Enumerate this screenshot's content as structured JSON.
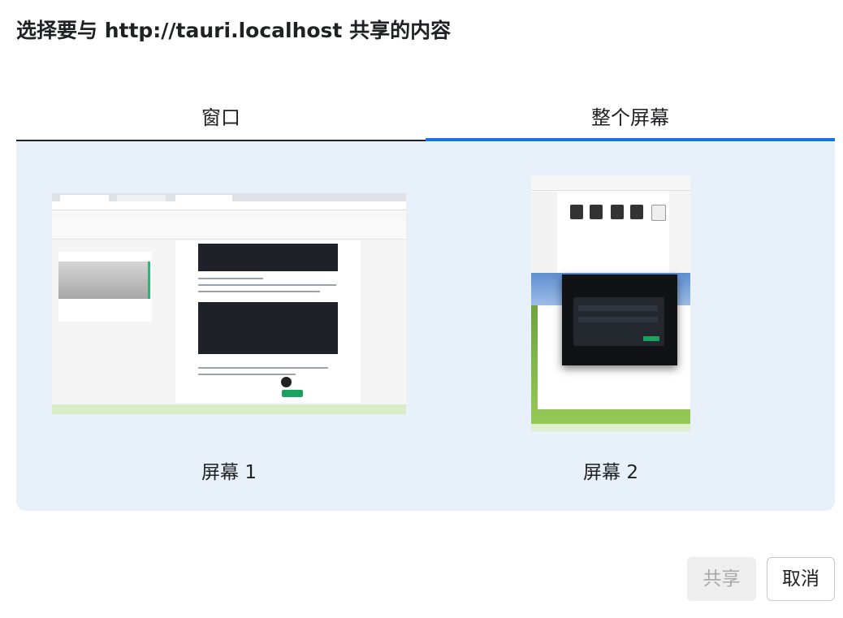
{
  "dialog": {
    "title": "选择要与 http://tauri.localhost 共享的内容"
  },
  "tabs": [
    {
      "label": "窗口",
      "selected": false
    },
    {
      "label": "整个屏幕",
      "selected": true
    }
  ],
  "sources": [
    {
      "label": "屏幕 1"
    },
    {
      "label": "屏幕 2"
    }
  ],
  "buttons": {
    "share_label": "共享",
    "share_enabled": false,
    "cancel_label": "取消"
  },
  "colors": {
    "accent": "#1a73e8",
    "panel_bg": "#e8f0fa",
    "disabled_bg": "#eeeeee"
  }
}
